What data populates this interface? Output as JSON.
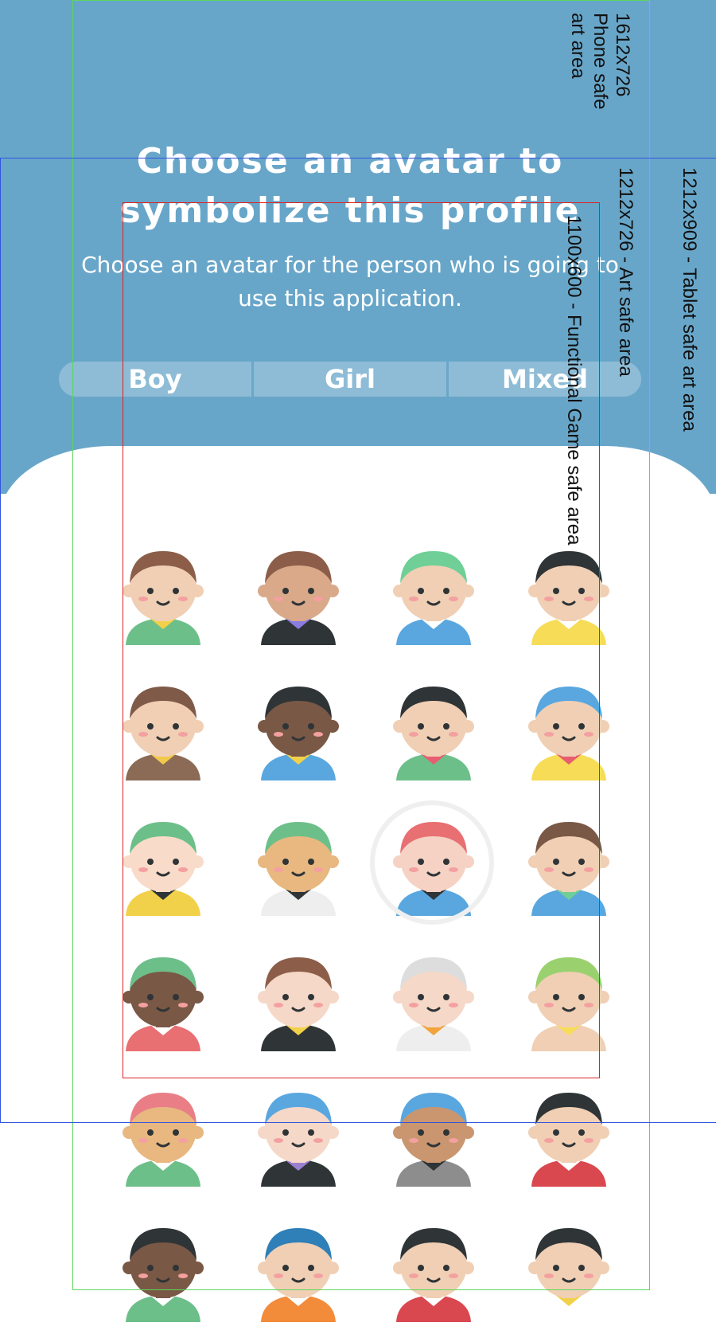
{
  "header": {
    "title_line1": "Choose an avatar to",
    "title_line2": "symbolize this profile",
    "subtitle": "Choose an avatar for the person who is going to use this application."
  },
  "tabs": [
    {
      "label": "Boy"
    },
    {
      "label": "Girl"
    },
    {
      "label": "Mixed"
    }
  ],
  "colors": {
    "header_bg": "#68a6c9",
    "panel_bg": "#ffffff",
    "selected_ring": "#efefef"
  },
  "avatars": [
    {
      "name": "spiky-hair-boy",
      "skin": "#f0cfb4",
      "hair": "#8c5e4a",
      "shirt": "#6dbf8a",
      "accent": "#f2d14a",
      "selected": false
    },
    {
      "name": "hooded-boy",
      "skin": "#d9a98a",
      "hair": "#8c5e4a",
      "shirt": "#2f3437",
      "accent": "#8a7ce0",
      "selected": false
    },
    {
      "name": "green-hair-boy",
      "skin": "#f0cfb4",
      "hair": "#6fcf97",
      "shirt": "#5aa7df",
      "accent": "#ffffff",
      "selected": false
    },
    {
      "name": "pirate-hat-boy",
      "skin": "#f0cfb4",
      "hair": "#2f3437",
      "shirt": "#f7dc57",
      "accent": "#ffffff",
      "selected": false
    },
    {
      "name": "viking-boy",
      "skin": "#f0cfb4",
      "hair": "#7f5a48",
      "shirt": "#8b6a56",
      "accent": "#f2c94c",
      "selected": false
    },
    {
      "name": "headband-boy",
      "skin": "#7a5846",
      "hair": "#2f3437",
      "shirt": "#5aa7df",
      "accent": "#f2d14a",
      "selected": false
    },
    {
      "name": "party-hat-boy",
      "skin": "#f0cfb4",
      "hair": "#2f3437",
      "shirt": "#6dbf8a",
      "accent": "#e85d6f",
      "selected": false
    },
    {
      "name": "baby-boy",
      "skin": "#f0cfb4",
      "hair": "#5aa7df",
      "shirt": "#f7dc57",
      "accent": "#e85d6f",
      "selected": false
    },
    {
      "name": "green-hair-girl",
      "skin": "#f8dbc8",
      "hair": "#6dbf8a",
      "shirt": "#f2d14a",
      "accent": "#2f3437",
      "selected": false
    },
    {
      "name": "bandana-boy",
      "skin": "#e8b880",
      "hair": "#6dbf8a",
      "shirt": "#eeeeee",
      "accent": "#2f3437",
      "selected": false
    },
    {
      "name": "eyepatch-boy",
      "skin": "#f5d2c4",
      "hair": "#e86f72",
      "shirt": "#5aa7df",
      "accent": "#2f3437",
      "selected": true
    },
    {
      "name": "visor-boy",
      "skin": "#f0cfb4",
      "hair": "#7a5846",
      "shirt": "#5aa7df",
      "accent": "#6fcf97",
      "selected": false
    },
    {
      "name": "sprout-boy",
      "skin": "#7a5846",
      "hair": "#6dbf8a",
      "shirt": "#e86f72",
      "accent": "#ffffff",
      "selected": false
    },
    {
      "name": "sheriff-boy",
      "skin": "#f5d8c8",
      "hair": "#8c5e4a",
      "shirt": "#2f3437",
      "accent": "#f2d14a",
      "selected": false
    },
    {
      "name": "knight-boy",
      "skin": "#f5d8c8",
      "hair": "#dddddd",
      "shirt": "#eeeeee",
      "accent": "#f2a33a",
      "selected": false
    },
    {
      "name": "wrestler-boy",
      "skin": "#f0cfb4",
      "hair": "#9ad16e",
      "shirt": "#f0cfb4",
      "accent": "#f7dc57",
      "selected": false
    },
    {
      "name": "pink-hair-boy",
      "skin": "#e8b880",
      "hair": "#e97e86",
      "shirt": "#6dbf8a",
      "accent": "#ffffff",
      "selected": false
    },
    {
      "name": "mohawk-boy",
      "skin": "#f5d8c8",
      "hair": "#5aa7df",
      "shirt": "#2f3437",
      "accent": "#9b7fd1",
      "selected": false
    },
    {
      "name": "cap-beard-boy",
      "skin": "#c9966f",
      "hair": "#5aa7df",
      "shirt": "#8d8d8d",
      "accent": "#2f3437",
      "selected": false
    },
    {
      "name": "black-hair-boy",
      "skin": "#f0cfb4",
      "hair": "#2f3437",
      "shirt": "#d9484f",
      "accent": "#ffffff",
      "selected": false
    },
    {
      "name": "curly-boy",
      "skin": "#7a5846",
      "hair": "#2f3437",
      "shirt": "#6dbf8a",
      "accent": "#ffffff",
      "selected": false
    },
    {
      "name": "beanie-boy",
      "skin": "#f0cfb4",
      "hair": "#2f7fb8",
      "shirt": "#f28b3a",
      "accent": "#ffffff",
      "selected": false
    },
    {
      "name": "pirate-captain",
      "skin": "#f0cfb4",
      "hair": "#2f3437",
      "shirt": "#d9484f",
      "accent": "#ffffff",
      "selected": false
    },
    {
      "name": "sweatband-boy",
      "skin": "#f0cfb4",
      "hair": "#2f3437",
      "shirt": "#ffffff",
      "accent": "#f2d14a",
      "selected": false
    }
  ],
  "overlay": {
    "phone_safe": "1612x726\nPhone safe\nart area",
    "art_safe": "1212x726 - Art safe area",
    "tablet_safe": "1212x909 - Tablet safe art area",
    "functional_safe": "1100x600 - Functional Game safe area",
    "phone_color": "#5cd65c",
    "tablet_color": "#3355dd",
    "functional_color": "#dd2222"
  }
}
